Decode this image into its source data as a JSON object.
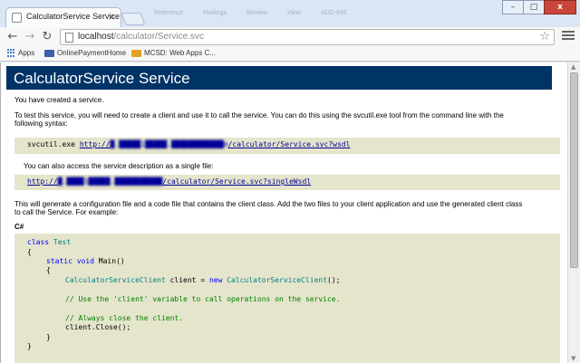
{
  "browser": {
    "tab_title": "CalculatorService Service",
    "tab_close": "×",
    "address": {
      "host": "localhost",
      "path": "/calculator/Service.svc"
    },
    "bookmarks": [
      {
        "label": "Apps",
        "icon": "apps-grid-icon"
      },
      {
        "label": "OnlinePaymentHome",
        "icon": "bookmark-icon"
      },
      {
        "label": "MCSD: Web Apps C...",
        "icon": "bookmark-icon"
      }
    ],
    "ghost_menu": [
      "Reference",
      "Mailings",
      "Review",
      "View",
      "ADD-INS"
    ],
    "window_controls": {
      "minimize": "–",
      "maximize": "□",
      "close": "x"
    }
  },
  "page": {
    "heading": "CalculatorService Service",
    "created_text": "You have created a service.",
    "test_intro_line1": "To test this service, you will need to create a client and use it to call the service. You can do this using the svcutil.exe tool from the command line with the",
    "test_intro_line2": "following syntax:",
    "svcutil_cmd": "svcutil.exe",
    "wsdl_link_prefix": "http://",
    "wsdl_link_blurred": "█.█████1█████.████████████m",
    "wsdl_link_suffix": "/calculator/Service.svc?wsdl",
    "single_file_text": "You can also access the service description as a single file:",
    "singlewsdl_link_prefix": "http://",
    "singlewsdl_link_blurred": "█.████1█████.███████████",
    "singlewsdl_link_suffix": "/calculator/Service.svc?singleWsdl",
    "generate_line1": "This will generate a configuration file and a code file that contains the client class. Add the two files to your client application and use the generated client class",
    "generate_line2": "to call the Service. For example:",
    "csharp_label": "C#",
    "code": {
      "class_kw": "class",
      "class_name": "Test",
      "open_brace": "{",
      "static_void": "static void",
      "main_sig": " Main()",
      "inner_open": "{",
      "client_type": "CalculatorServiceClient",
      "client_var": " client = ",
      "new_kw": "new",
      "client_ctor": "CalculatorServiceClient",
      "ctor_end": "();",
      "comment1": "// Use the 'client' variable to call operations on the service.",
      "comment2": "// Always close the client.",
      "close_call": "client.Close();",
      "inner_close": "}",
      "close_brace": "}"
    }
  }
}
